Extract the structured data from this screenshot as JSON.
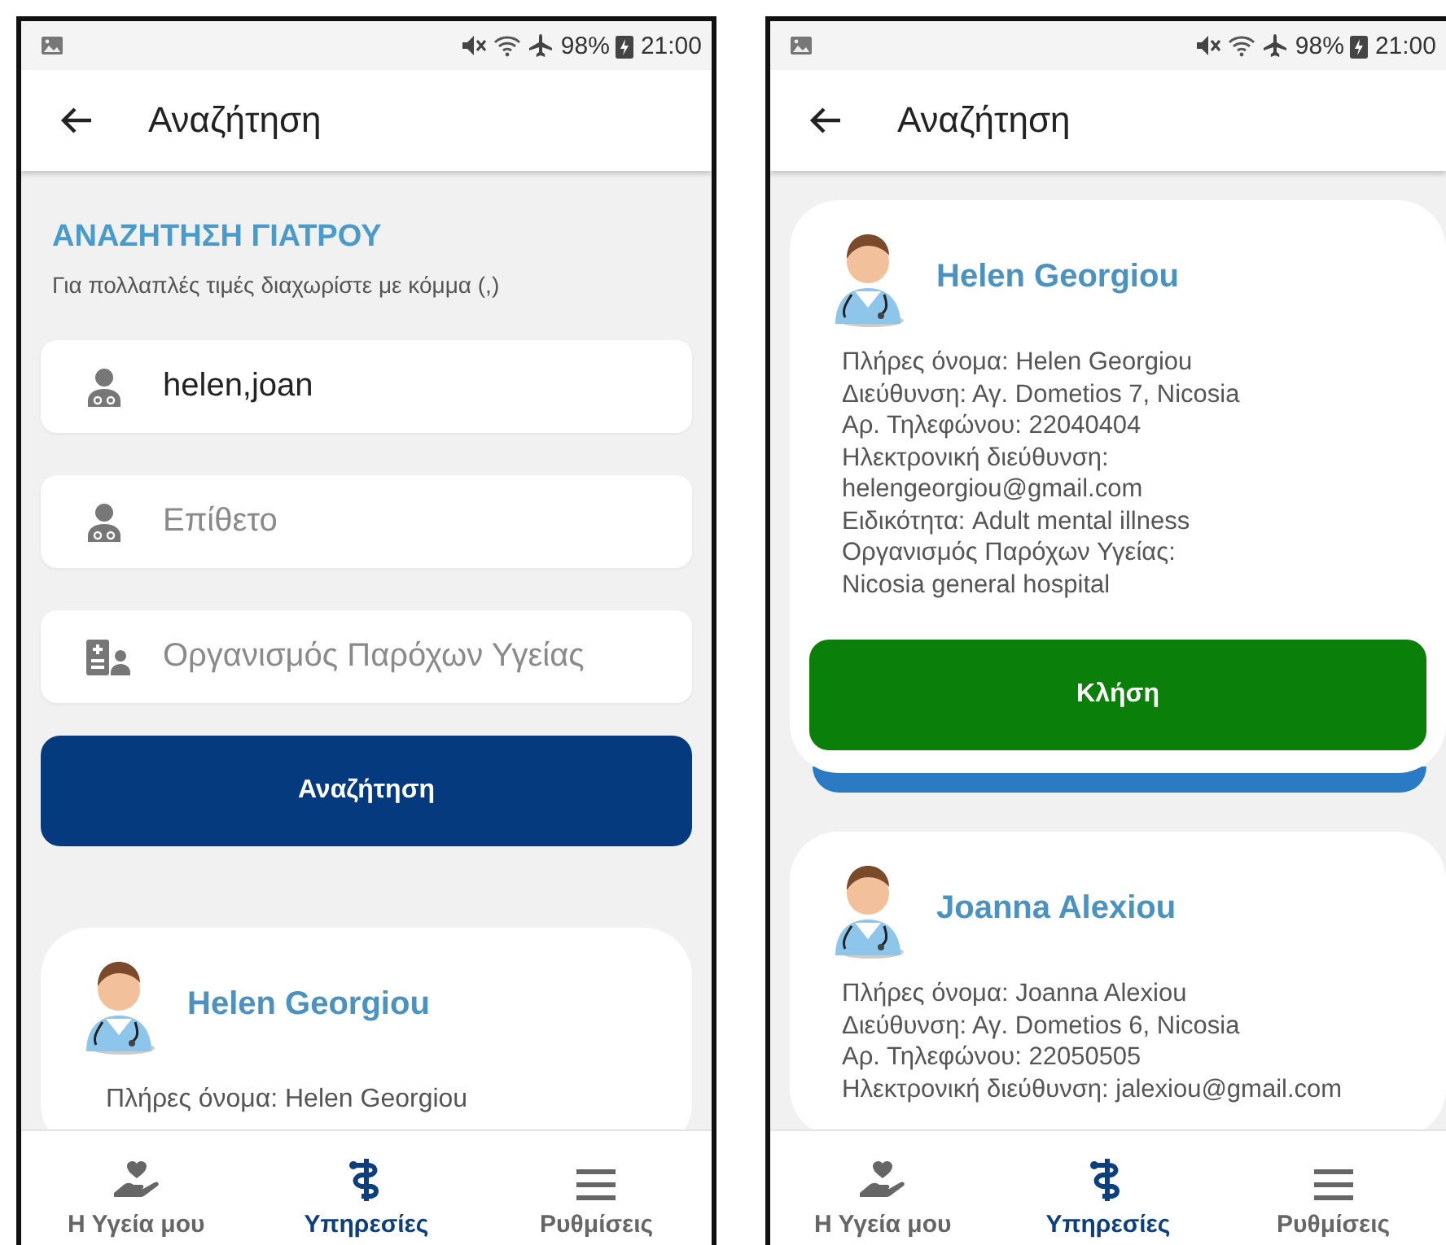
{
  "screens": [
    {
      "kind": "search",
      "status_bar": {
        "battery": "98%",
        "time": "21:00"
      },
      "app_bar": {
        "title": "Αναζήτηση"
      },
      "search_form": {
        "heading": "ΑΝΑΖΗΤΗΣΗ ΓΙΑΤΡΟΥ",
        "hint": "Για πολλαπλές τιμές διαχωρίστε με κόμμα (,)",
        "fields": [
          {
            "kind": "doctor",
            "value": "helen,joan"
          },
          {
            "kind": "doctor",
            "placeholder": "Επίθετο"
          },
          {
            "kind": "organization",
            "placeholder": "Οργανισμός Παρόχων Υγείας"
          }
        ],
        "button": "Αναζήτηση"
      },
      "results": [
        {
          "name": "Helen Georgiou",
          "details": [
            "Πλήρες όνομα:  Helen Georgiou"
          ]
        }
      ],
      "bottom_nav": [
        {
          "kind": "care",
          "label": "Η Υγεία μου",
          "selected": false
        },
        {
          "kind": "services",
          "label": "Υπηρεσίες",
          "selected": true
        },
        {
          "kind": "menu",
          "label": "Ρυθμίσεις",
          "selected": false
        }
      ]
    },
    {
      "kind": "results",
      "status_bar": {
        "battery": "98%",
        "time": "21:00"
      },
      "app_bar": {
        "title": "Αναζήτηση"
      },
      "results": [
        {
          "name": "Helen Georgiou",
          "details": [
            "Πλήρες όνομα:  Helen Georgiou",
            "Διεύθυνση:  Αγ. Dometios 7, Nicosia",
            "Αρ. Τηλεφώνου:  22040404",
            "Ηλεκτρονική διεύθυνση:",
            "helengeorgiou@gmail.com",
            "Ειδικότητα:  Adult mental illness",
            "Οργανισμός Παρόχων Υγείας:",
            "Nicosia general hospital"
          ],
          "call_button": "Κλήση"
        },
        {
          "name": "Joanna Alexiou",
          "details": [
            "Πλήρες όνομα:  Joanna Alexiou",
            "Διεύθυνση:  Αγ. Dometios 6, Nicosia",
            "Αρ. Τηλεφώνου:  22050505",
            "Ηλεκτρονική διεύθυνση:  jalexiou@gmail.com"
          ]
        }
      ],
      "bottom_nav": [
        {
          "kind": "care",
          "label": "Η Υγεία μου",
          "selected": false
        },
        {
          "kind": "services",
          "label": "Υπηρεσίες",
          "selected": true
        },
        {
          "kind": "menu",
          "label": "Ρυθμίσεις",
          "selected": false
        }
      ]
    }
  ]
}
